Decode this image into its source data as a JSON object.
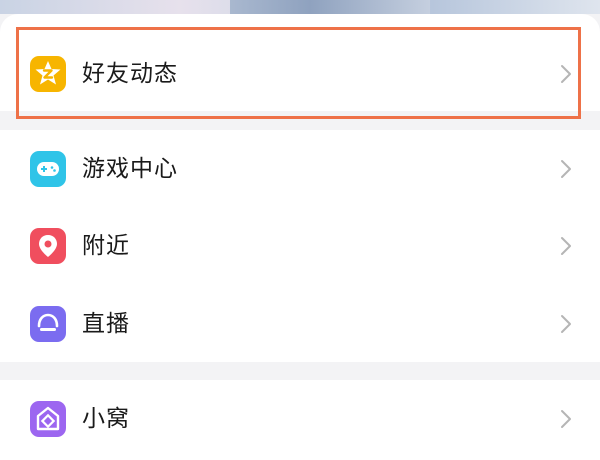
{
  "menu": {
    "items": [
      {
        "label": "好友动态",
        "icon": "friends-feed-star-icon",
        "color": "#f7b500"
      },
      {
        "label": "游戏中心",
        "icon": "gamepad-icon",
        "color": "#2fc4e8"
      },
      {
        "label": "附近",
        "icon": "location-pin-icon",
        "color": "#f04e5e"
      },
      {
        "label": "直播",
        "icon": "live-icon",
        "color": "#7b6cf0"
      },
      {
        "label": "小窝",
        "icon": "home-icon",
        "color": "#9c66f0"
      }
    ]
  },
  "highlight": {
    "target": "好友动态",
    "color": "#ee7148"
  }
}
